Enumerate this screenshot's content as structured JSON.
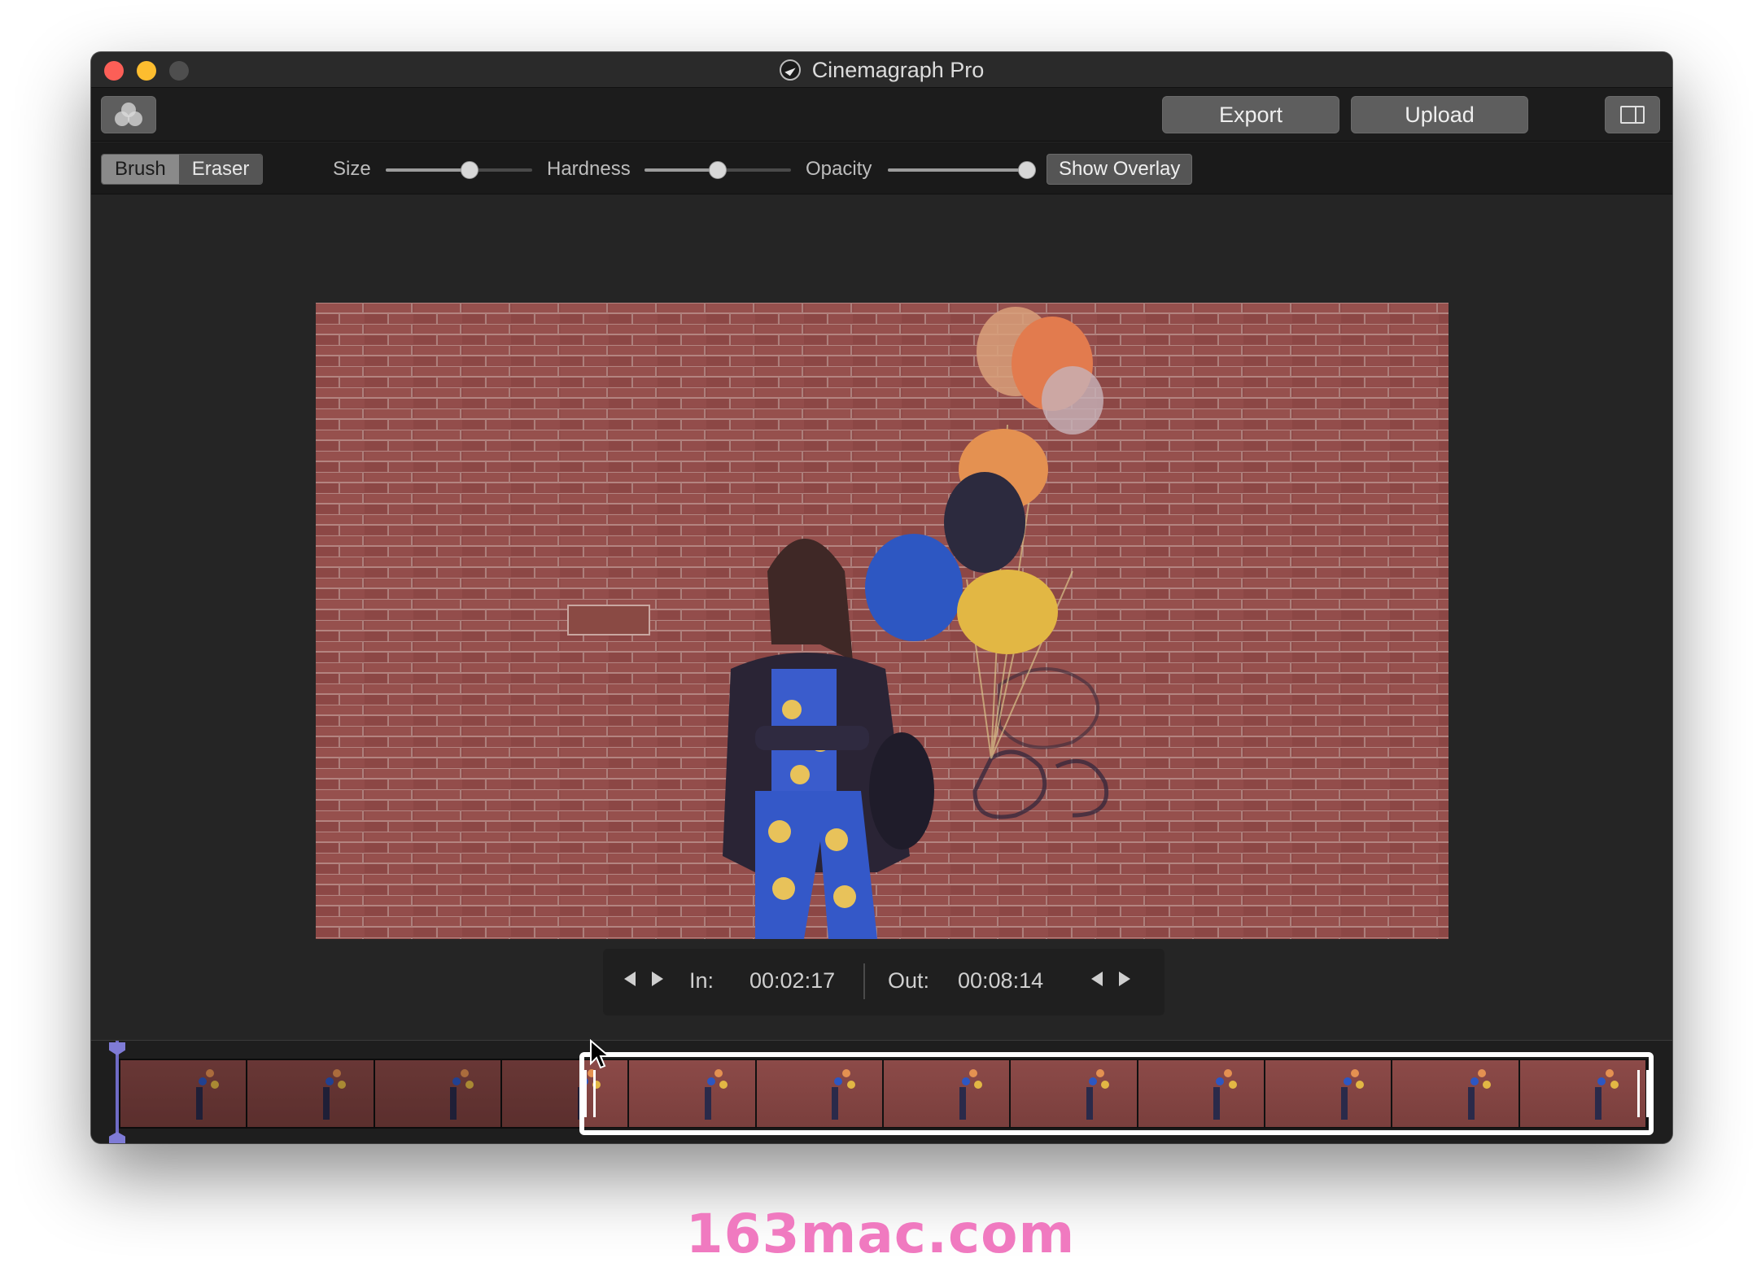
{
  "window": {
    "title": "Cinemagraph Pro"
  },
  "toolbar": {
    "export_label": "Export",
    "upload_label": "Upload",
    "filter_icon": "color-filters-icon",
    "sidebar_icon": "sidebar-toggle-icon"
  },
  "brush_bar": {
    "modes": [
      {
        "label": "Brush",
        "active": true
      },
      {
        "label": "Eraser",
        "active": false
      }
    ],
    "size_label": "Size",
    "size_value": 0.57,
    "hardness_label": "Hardness",
    "hardness_value": 0.5,
    "opacity_label": "Opacity",
    "opacity_value": 0.95,
    "overlay_label": "Show Overlay"
  },
  "trim": {
    "in_label": "In:",
    "in_time": "00:02:17",
    "out_label": "Out:",
    "out_time": "00:08:14"
  },
  "timeline": {
    "frame_count": 12,
    "selection_start_frame": 4
  },
  "watermark": "163mac.com",
  "colors": {
    "close": "#fc5f57",
    "minimize": "#fdbd2f",
    "playhead": "#7f7bd6",
    "selection": "#ffffff",
    "watermark": "#f07ac0"
  }
}
